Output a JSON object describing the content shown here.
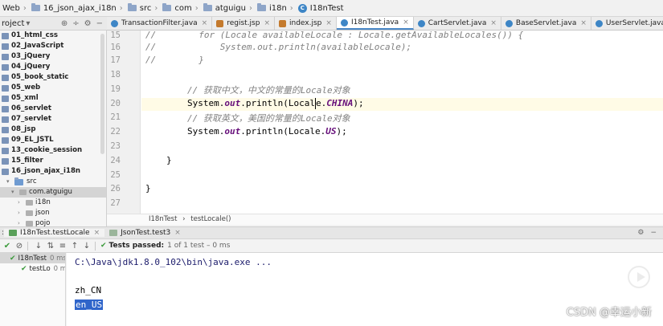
{
  "breadcrumb": [
    {
      "label": "Web",
      "icon": "module-icon"
    },
    {
      "label": "16_json_ajax_i18n",
      "icon": "folder-icon"
    },
    {
      "label": "src",
      "icon": "folder-icon"
    },
    {
      "label": "com",
      "icon": "folder-icon"
    },
    {
      "label": "atguigu",
      "icon": "folder-icon"
    },
    {
      "label": "i18n",
      "icon": "folder-icon"
    },
    {
      "label": "I18nTest",
      "icon": "class-icon"
    }
  ],
  "project_panel": {
    "title": "roject",
    "tools": [
      "⊕",
      "÷",
      "⚙",
      "−"
    ]
  },
  "project_tree": [
    {
      "label": "01_html_css",
      "type": "module"
    },
    {
      "label": "02_JavaScript",
      "type": "module"
    },
    {
      "label": "03_jQuery",
      "type": "module"
    },
    {
      "label": "04_jQuery",
      "type": "module"
    },
    {
      "label": "05_book_static",
      "type": "module"
    },
    {
      "label": "05_web",
      "type": "module"
    },
    {
      "label": "05_xml",
      "type": "module"
    },
    {
      "label": "06_servlet",
      "type": "module"
    },
    {
      "label": "07_servlet",
      "type": "module"
    },
    {
      "label": "08_jsp",
      "type": "module"
    },
    {
      "label": "09_EL_JSTL",
      "type": "module"
    },
    {
      "label": "13_cookie_session",
      "type": "module"
    },
    {
      "label": "15_filter",
      "type": "module"
    },
    {
      "label": "16_json_ajax_i18n",
      "type": "module"
    },
    {
      "label": "src",
      "type": "folder"
    },
    {
      "label": "com.atguigu",
      "type": "package",
      "selected": true
    },
    {
      "label": "i18n",
      "type": "package"
    },
    {
      "label": "json",
      "type": "package"
    },
    {
      "label": "pojo",
      "type": "package"
    }
  ],
  "editor_tabs": [
    {
      "label": "TransactionFilter.java",
      "kind": "java"
    },
    {
      "label": "regist.jsp",
      "kind": "jsp"
    },
    {
      "label": "index.jsp",
      "kind": "jsp"
    },
    {
      "label": "I18nTest.java",
      "kind": "java",
      "active": true
    },
    {
      "label": "CartServlet.java",
      "kind": "java"
    },
    {
      "label": "BaseServlet.java",
      "kind": "java"
    },
    {
      "label": "UserServlet.java",
      "kind": "java"
    }
  ],
  "code_lines": [
    {
      "num": "15",
      "text": "//        for (Locale availableLocale : Locale.getAvailableLocales()) {"
    },
    {
      "num": "16",
      "text": "//            System.out.println(availableLocale);"
    },
    {
      "num": "17",
      "text": "//        }"
    },
    {
      "num": "18",
      "text": ""
    },
    {
      "num": "19",
      "text": "        // 获取中文，中文的常量的Locale对象"
    },
    {
      "num": "20",
      "text": "        System.out.println(Locale.CHINA);"
    },
    {
      "num": "21",
      "text": "        // 获取英文，美国的常量的Locale对象"
    },
    {
      "num": "22",
      "text": "        System.out.println(Locale.US);"
    },
    {
      "num": "23",
      "text": ""
    },
    {
      "num": "24",
      "text": "    }"
    },
    {
      "num": "25",
      "text": ""
    },
    {
      "num": "26",
      "text": "}"
    },
    {
      "num": "27",
      "text": ""
    }
  ],
  "code_tokens": {
    "c15": "//        for (Locale availableLocale : Locale.getAvailableLocales()) {",
    "c16": "//            System.out.println(availableLocale);",
    "c17": "//        }",
    "c19": "// 获取中文，中文的常量的Locale对象",
    "sys": "System.",
    "out": "out",
    "println20a": ".println(Local",
    "println20b": "e.",
    "china": "CHINA",
    "end": ");",
    "c21": "// 获取英文，美国的常量的Locale对象",
    "println22": ".println(Locale.",
    "us": "US",
    "brace_method": "}",
    "brace_class": "}"
  },
  "editor_crumb": {
    "cls": "I18nTest",
    "sep": "›",
    "method": "testLocale()"
  },
  "run_tabs": [
    {
      "label": "I18nTest.testLocale",
      "active": true
    },
    {
      "label": "JsonTest.test3",
      "active": false
    }
  ],
  "run_settings": [
    "⚙",
    "−"
  ],
  "run_toolbar": {
    "passed_label": "Tests passed:",
    "passed_detail": "1 of 1 test – 0 ms"
  },
  "test_tree": [
    {
      "label": "I18nTest",
      "time": "0 ms"
    },
    {
      "label": "testLo",
      "time": "0 ms"
    }
  ],
  "console": {
    "cmd": "C:\\Java\\jdk1.8.0_102\\bin\\java.exe ...",
    "line1": "zh_CN",
    "line2": "en_US"
  },
  "watermark": "CSDN @幸运小新"
}
